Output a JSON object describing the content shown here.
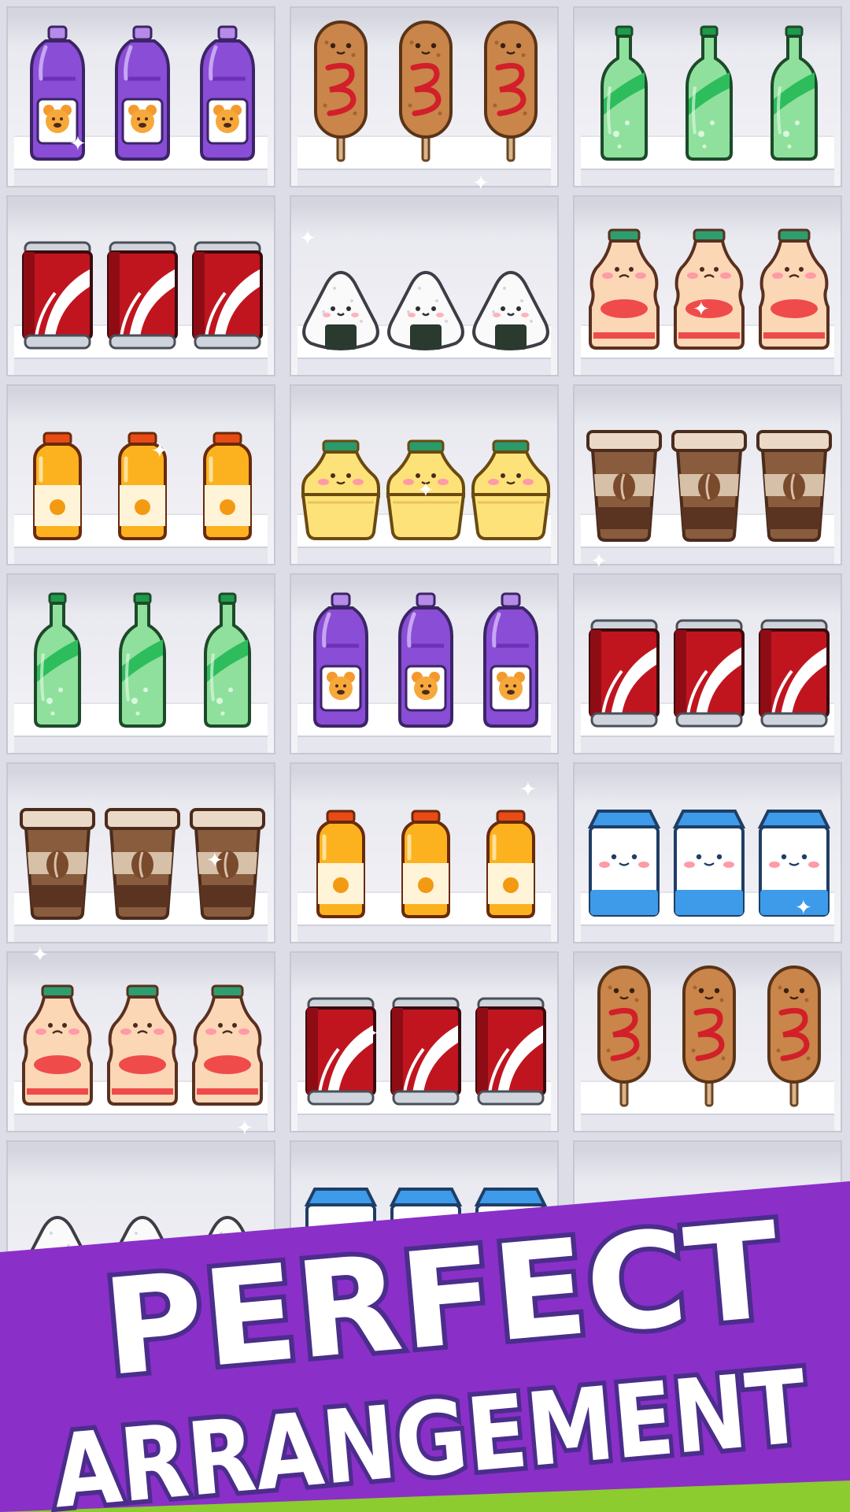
{
  "title": {
    "line1": "PERFECT",
    "line2": "ARRANGEMENT"
  },
  "colors": {
    "banner_purple": "#8b2fc9",
    "banner_green": "#8ccc2e",
    "title_fill": "#ffffff",
    "title_outline": "#4b2d8c"
  },
  "shelves": [
    {
      "item": "grape-juice-bottle",
      "count": 3
    },
    {
      "item": "corn-dog",
      "count": 3
    },
    {
      "item": "green-soda-bottle",
      "count": 3
    },
    {
      "item": "cola-can",
      "count": 3
    },
    {
      "item": "onigiri",
      "count": 3
    },
    {
      "item": "yogurt-drink",
      "count": 3
    },
    {
      "item": "orange-juice-bottle",
      "count": 3
    },
    {
      "item": "banana-milk",
      "count": 3
    },
    {
      "item": "coffee-cup",
      "count": 3
    },
    {
      "item": "green-soda-bottle",
      "count": 3
    },
    {
      "item": "grape-juice-bottle",
      "count": 3
    },
    {
      "item": "cola-can",
      "count": 3
    },
    {
      "item": "coffee-cup",
      "count": 3
    },
    {
      "item": "orange-juice-bottle",
      "count": 3
    },
    {
      "item": "milk-carton",
      "count": 3
    },
    {
      "item": "yogurt-drink",
      "count": 3
    },
    {
      "item": "cola-can",
      "count": 3
    },
    {
      "item": "corn-dog",
      "count": 3
    },
    {
      "item": "onigiri",
      "count": 3
    },
    {
      "item": "milk-carton",
      "count": 3
    },
    {
      "item": "",
      "count": 0
    }
  ]
}
